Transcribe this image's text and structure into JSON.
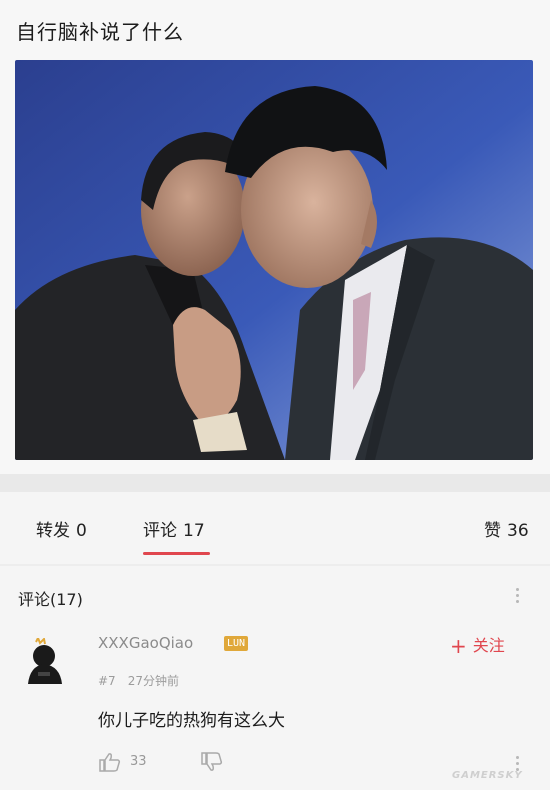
{
  "post": {
    "title": "自行脑补说了什么"
  },
  "stats": {
    "repost_label": "转发",
    "repost_count": "0",
    "comment_label": "评论",
    "comment_count": "17",
    "like_label": "赞",
    "like_count": "36",
    "active_tab": "comments",
    "accent_color": "#e0464e"
  },
  "comments": {
    "header": "评论(17)",
    "items": [
      {
        "username": "XXXGaoQiao",
        "badge": "LUN",
        "follow_label": "关注",
        "floor": "#7",
        "time": "27分钟前",
        "text": "你儿子吃的热狗有这么大",
        "likes": "33"
      }
    ]
  },
  "watermark": "GAMERSKY"
}
